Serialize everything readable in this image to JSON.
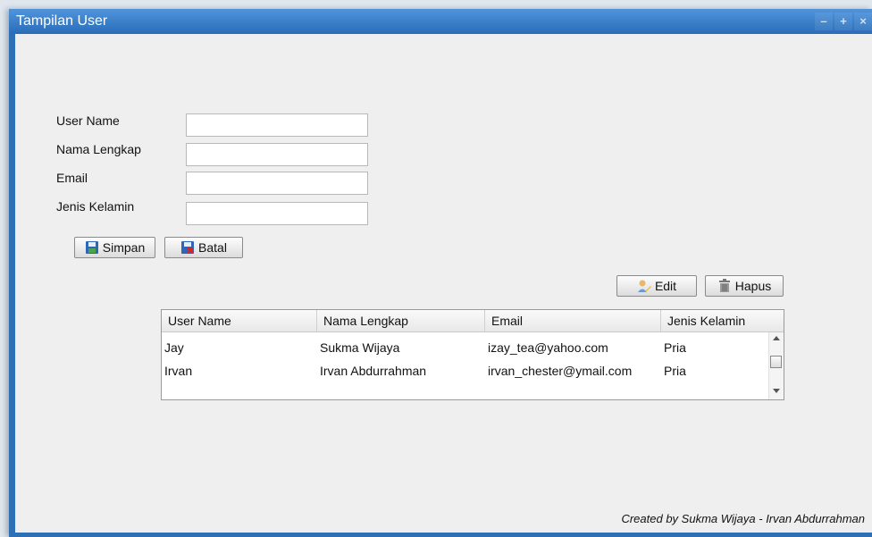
{
  "window": {
    "title": "Tampilan User",
    "controls": [
      "minimize-icon",
      "maximize-icon",
      "close-icon"
    ]
  },
  "form": {
    "fields": [
      {
        "label": "User Name",
        "value": ""
      },
      {
        "label": "Nama Lengkap",
        "value": ""
      },
      {
        "label": "Email",
        "value": ""
      },
      {
        "label": "Jenis Kelamin",
        "value": ""
      }
    ],
    "buttons": {
      "save": "Simpan",
      "cancel": "Batal"
    }
  },
  "actions": {
    "edit": "Edit",
    "delete": "Hapus"
  },
  "table": {
    "columns": [
      "User Name",
      "Nama Lengkap",
      "Email",
      "Jenis Kelamin"
    ],
    "rows": [
      [
        "Jay",
        "Sukma Wijaya",
        "izay_tea@yahoo.com",
        "Pria"
      ],
      [
        "Irvan",
        "Irvan Abdurrahman",
        "irvan_chester@ymail.com",
        "Pria"
      ]
    ]
  },
  "footer": "Created by Sukma Wijaya - Irvan Abdurrahman",
  "colors": {
    "titlebar": "#2f6fb5",
    "background": "#efefef"
  }
}
